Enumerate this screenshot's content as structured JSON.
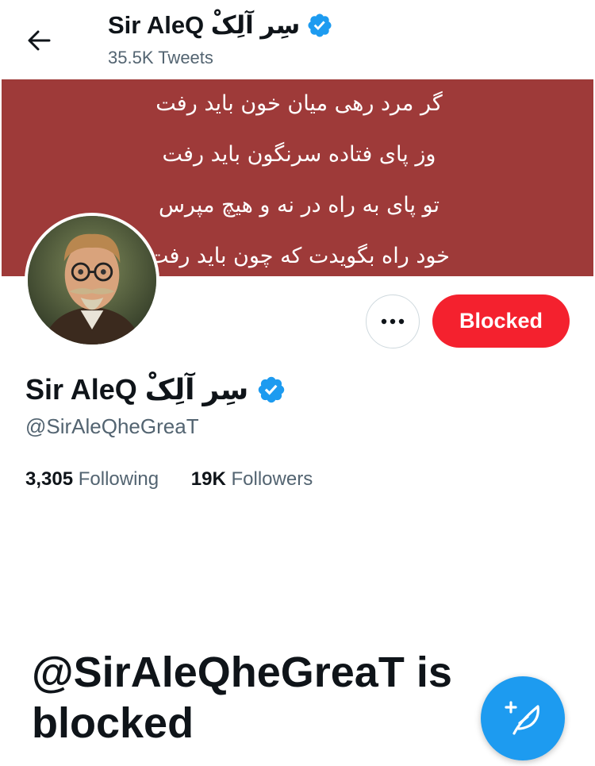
{
  "header": {
    "name": "Sir AleQ سِر آلِکْ",
    "tweet_count": "35.5K Tweets"
  },
  "banner": {
    "color": "#9e3a39",
    "lines": [
      "گر مرد رهی میان خون باید رفت",
      "وز پای فتاده سرنگون باید رفت",
      "تو پای به راه در نه و هیچ مپرس",
      "خود راه بگویدت که چون باید رفت"
    ]
  },
  "profile": {
    "name": "Sir AleQ سِر آلِکْ",
    "handle": "@SirAleQheGreaT",
    "following_count": "3,305",
    "following_label": "Following",
    "followers_count": "19K",
    "followers_label": "Followers"
  },
  "actions": {
    "blocked_label": "Blocked",
    "blocked_color": "#f4212e",
    "more_icon": "more-horizontal-icon"
  },
  "blocked_notice": {
    "heading": "@SirAleQheGreaT is blocked"
  },
  "fab": {
    "icon": "compose-tweet-icon",
    "color": "#1d9bf0"
  }
}
